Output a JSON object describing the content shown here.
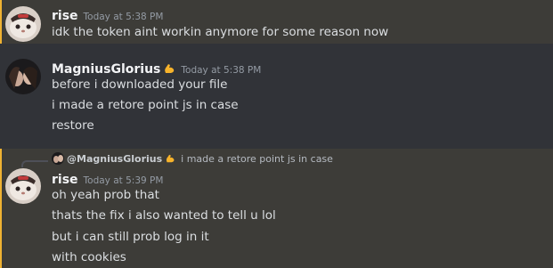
{
  "messages": [
    {
      "author": "rise",
      "timestamp": "Today at 5:38 PM",
      "lines": [
        "idk the token aint workin anymore for some reason now"
      ]
    },
    {
      "author": "MagniusGlorius",
      "author_emoji": "flexed-biceps-icon",
      "timestamp": "Today at 5:38 PM",
      "lines": [
        "before i downloaded your file",
        "i made a retore point js in case",
        "restore"
      ]
    },
    {
      "reply_to": {
        "author": "@MagniusGlorius",
        "author_emoji": "flexed-biceps-icon",
        "text": "i made a retore point js in case"
      },
      "author": "rise",
      "timestamp": "Today at 5:39 PM",
      "lines": [
        "oh yeah prob that",
        "thats the fix i also wanted to tell u lol",
        "but i can still prob log in it",
        "with cookies"
      ]
    }
  ],
  "colors": {
    "background": "#313338",
    "highlight": "#3d3c38",
    "mention_bar": "#f0b232",
    "text": "#dbdee1",
    "timestamp": "#949ba4"
  }
}
